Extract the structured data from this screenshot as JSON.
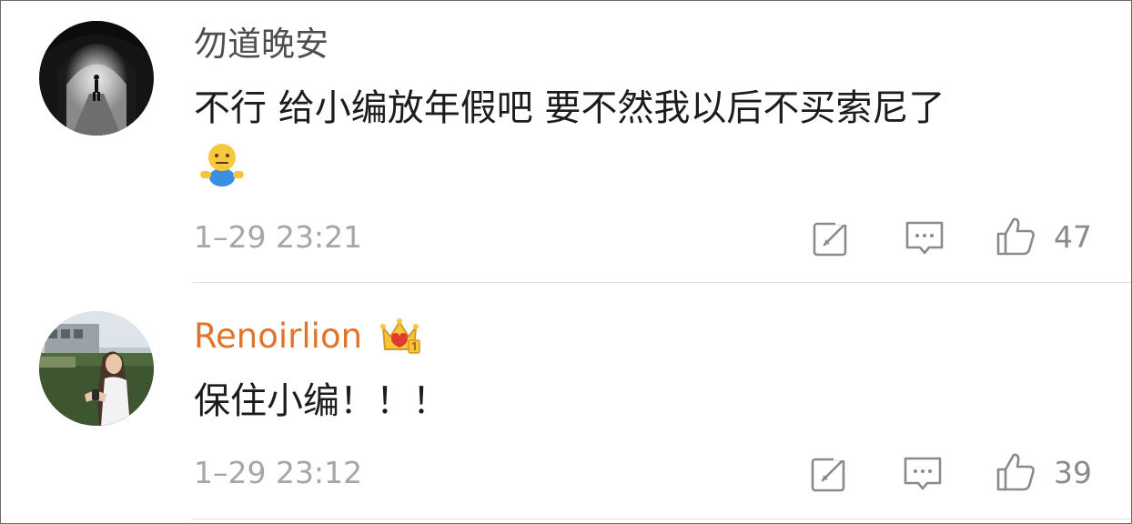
{
  "comments": [
    {
      "username": "勿道晚安",
      "text": "不行 给小编放年假吧 要不然我以后不买索尼了",
      "emoji": "shrug-emoji",
      "time": "1–29 23:21",
      "likes": "47",
      "avatar": "tunnel-silhouette-photo"
    },
    {
      "username": "Renoirlion",
      "badge": "crown-icon",
      "text": "保住小编！！！",
      "time": "1–29 23:12",
      "likes": "39",
      "avatar": "woman-with-phone-photo"
    }
  ],
  "colors": {
    "username_default": "#4e4e4e",
    "username_vip": "#e0742c",
    "text": "#1c1c1c",
    "meta": "#a6a6a6",
    "icon": "#8a8a8a"
  }
}
